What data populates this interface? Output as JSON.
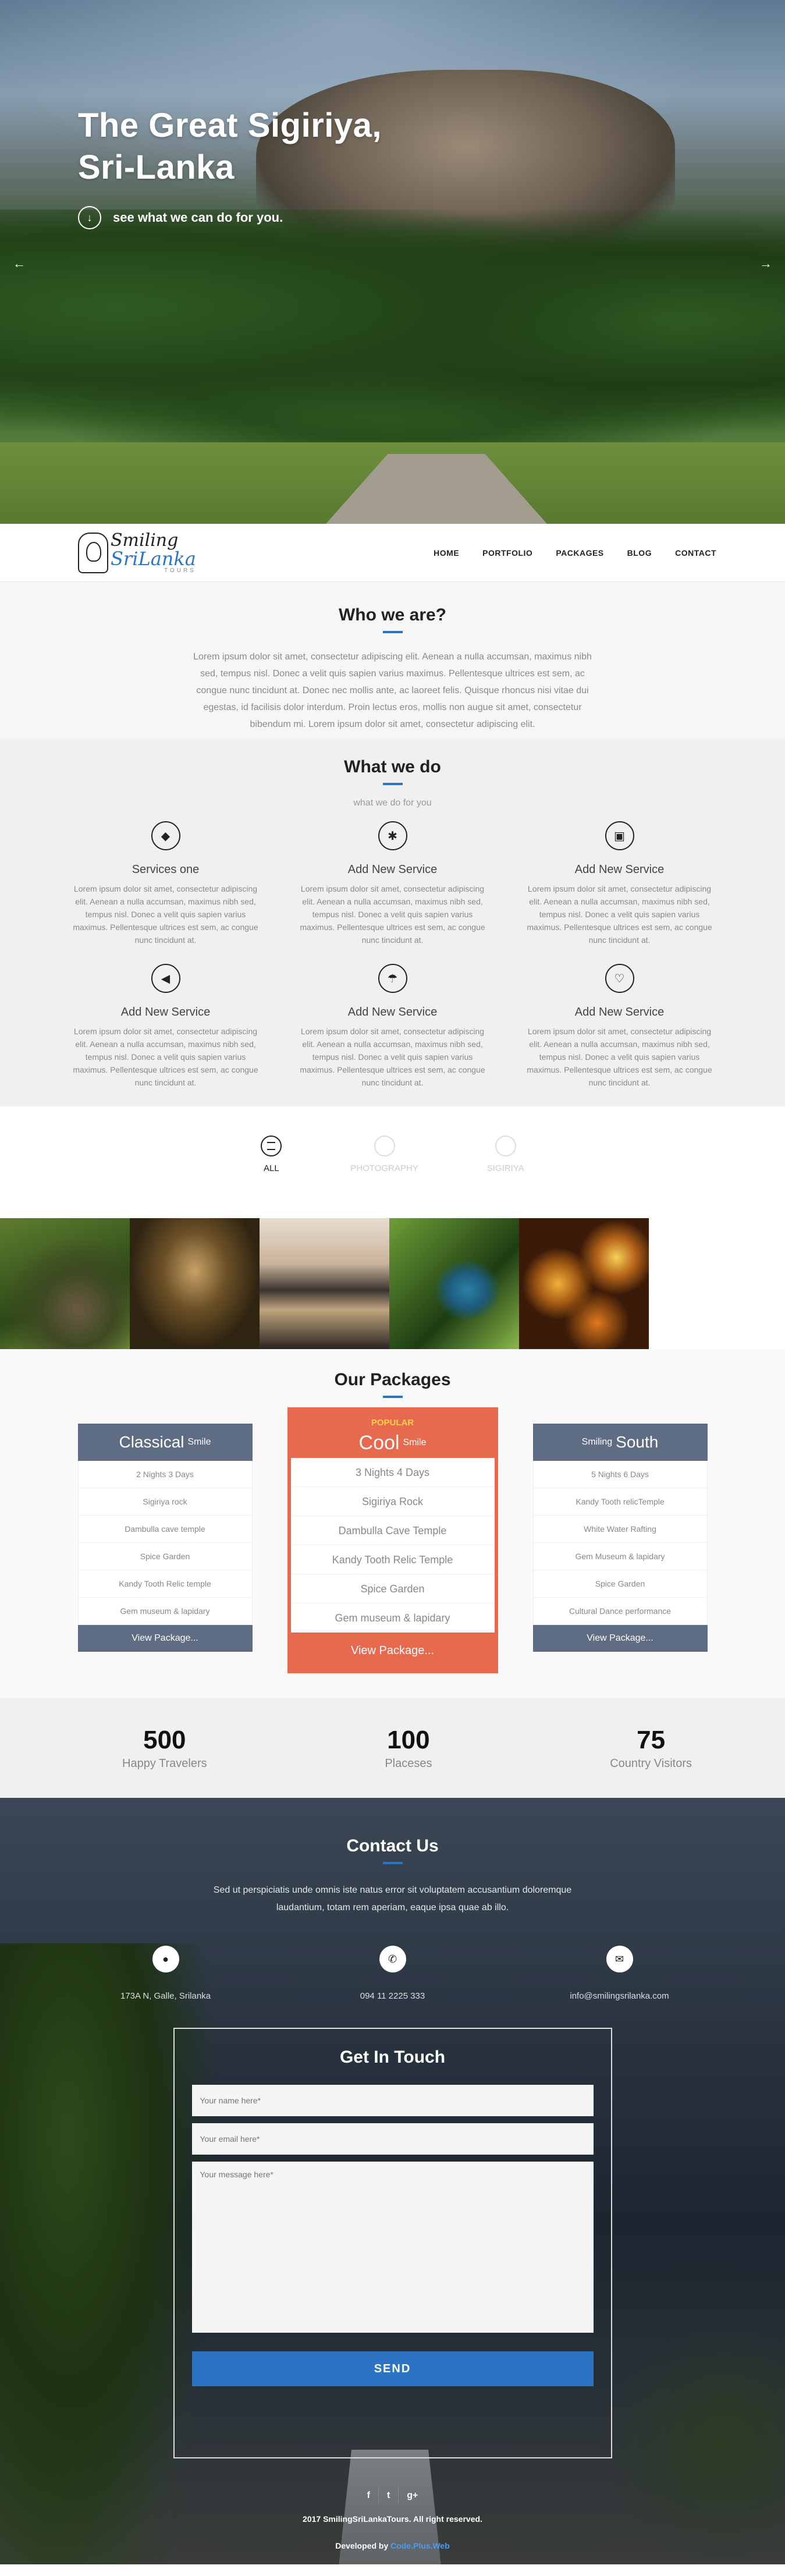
{
  "hero": {
    "title_line1": "The Great Sigiriya,",
    "title_line2": "Sri-Lanka",
    "subtitle": "see what we can do for you.",
    "prev": "←",
    "next": "→"
  },
  "logo": {
    "word1": "Smiling",
    "word2": "SriLanka",
    "word3": "TOURS"
  },
  "nav": [
    "HOME",
    "PORTFOLIO",
    "PACKAGES",
    "BLOG",
    "CONTACT"
  ],
  "who": {
    "title": "Who we are?",
    "text": "Lorem ipsum dolor sit amet, consectetur adipiscing elit. Aenean a nulla accumsan, maximus nibh sed, tempus nisl. Donec a velit quis sapien varius maximus. Pellentesque ultrices est sem, ac congue nunc tincidunt at. Donec nec mollis ante, ac laoreet felis. Quisque rhoncus nisi vitae dui egestas, id facilisis dolor interdum. Proin lectus eros, mollis non augue sit amet, consectetur bibendum mi. Lorem ipsum dolor sit amet, consectetur adipiscing elit."
  },
  "whatwedo": {
    "title": "What we do",
    "subtitle": "what we do for you",
    "services": [
      {
        "icon": "tag-icon",
        "glyph": "◆",
        "title": "Services one",
        "desc": "Lorem ipsum dolor sit amet, consectetur adipiscing elit. Aenean a nulla accumsan, maximus nibh sed, tempus nisl. Donec a velit quis sapien varius maximus. Pellentesque ultrices est sem, ac congue nunc tincidunt at."
      },
      {
        "icon": "star-icon",
        "glyph": "✱",
        "title": "Add New Service",
        "desc": "Lorem ipsum dolor sit amet, consectetur adipiscing elit. Aenean a nulla accumsan, maximus nibh sed, tempus nisl. Donec a velit quis sapien varius maximus. Pellentesque ultrices est sem, ac congue nunc tincidunt at."
      },
      {
        "icon": "calendar-icon",
        "glyph": "▣",
        "title": "Add New Service",
        "desc": "Lorem ipsum dolor sit amet, consectetur adipiscing elit. Aenean a nulla accumsan, maximus nibh sed, tempus nisl. Donec a velit quis sapien varius maximus. Pellentesque ultrices est sem, ac congue nunc tincidunt at."
      },
      {
        "icon": "arrow-left-icon",
        "glyph": "◀",
        "title": "Add New Service",
        "desc": "Lorem ipsum dolor sit amet, consectetur adipiscing elit. Aenean a nulla accumsan, maximus nibh sed, tempus nisl. Donec a velit quis sapien varius maximus. Pellentesque ultrices est sem, ac congue nunc tincidunt at."
      },
      {
        "icon": "umbrella-icon",
        "glyph": "☂",
        "title": "Add New Service",
        "desc": "Lorem ipsum dolor sit amet, consectetur adipiscing elit. Aenean a nulla accumsan, maximus nibh sed, tempus nisl. Donec a velit quis sapien varius maximus. Pellentesque ultrices est sem, ac congue nunc tincidunt at."
      },
      {
        "icon": "heart-icon",
        "glyph": "♡",
        "title": "Add New Service",
        "desc": "Lorem ipsum dolor sit amet, consectetur adipiscing elit. Aenean a nulla accumsan, maximus nibh sed, tempus nisl. Donec a velit quis sapien varius maximus. Pellentesque ultrices est sem, ac congue nunc tincidunt at."
      }
    ]
  },
  "filters": [
    "ALL",
    "PHOTOGRAPHY",
    "SIGIRIYA"
  ],
  "packages": {
    "title": "Our Packages",
    "popular_label": "POPULAR",
    "items": [
      {
        "name": "Classical",
        "tag": "Smile",
        "tag_first": false,
        "items": [
          "2 Nights 3 Days",
          "Sigiriya rock",
          "Dambulla cave temple",
          "Spice Garden",
          "Kandy Tooth Relic temple",
          "Gem museum & lapidary"
        ],
        "button": "View Package..."
      },
      {
        "name": "Cool",
        "tag": "Smile",
        "tag_first": false,
        "items": [
          "3 Nights 4 Days",
          "Sigiriya Rock",
          "Dambulla Cave Temple",
          "Kandy Tooth Relic Temple",
          "Spice Garden",
          "Gem museum & lapidary"
        ],
        "button": "View Package..."
      },
      {
        "name": "South",
        "tag": "Smiling",
        "tag_first": true,
        "items": [
          "5 Nights 6 Days",
          "Kandy Tooth relicTemple",
          "White Water Rafting",
          "Gem Museum & lapidary",
          "Spice Garden",
          "Cultural Dance performance"
        ],
        "button": "View Package..."
      }
    ]
  },
  "stats": [
    {
      "num": "500",
      "label": "Happy Travelers"
    },
    {
      "num": "100",
      "label": "Placeses"
    },
    {
      "num": "75",
      "label": "Country Visitors"
    }
  ],
  "contact": {
    "title": "Contact Us",
    "lead": "Sed ut perspiciatis unde omnis iste natus error sit voluptatem accusantium doloremque laudantium, totam rem aperiam, eaque ipsa quae ab illo.",
    "address": "173A N, Galle, Srilanka",
    "phone": "094 11 2225 333",
    "email": "info@smilingsrilanka.com",
    "form_title": "Get In Touch",
    "name_placeholder": "Your name here*",
    "email_placeholder": "Your email here*",
    "message_placeholder": "Your message here*",
    "send": "SEND"
  },
  "footer": {
    "facebook": "f",
    "twitter": "t",
    "google_plus": "g+",
    "copyright": "2017 SmilingSriLankaTours. All right reserved.",
    "dev_prefix": "Developed by ",
    "dev_name": "Code.Plus.Web"
  },
  "colors": {
    "accent": "#2a75c7",
    "popular": "#e86a4e",
    "package_head": "#5e6d84",
    "popular_label": "#ffd34a"
  }
}
